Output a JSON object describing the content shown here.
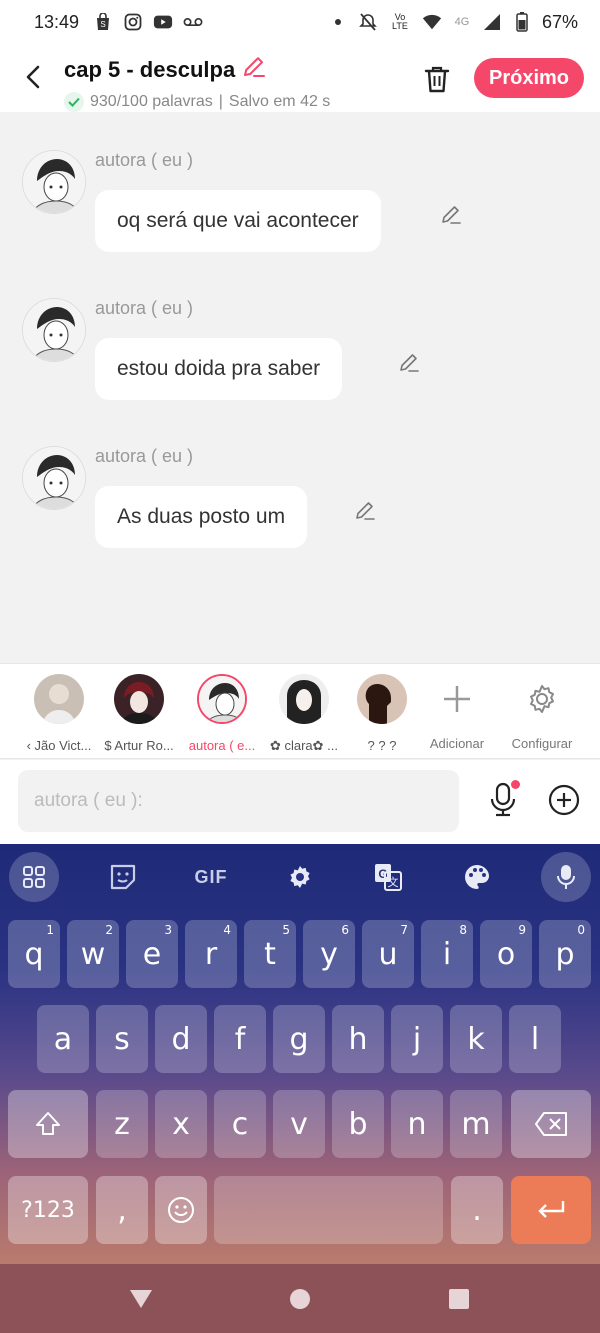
{
  "status_bar": {
    "time": "13:49",
    "battery": "67%",
    "network": "4G",
    "volte": "Vo LTE"
  },
  "header": {
    "title": "cap 5 - desculpa",
    "word_count": "930/100 palavras",
    "separator": "|",
    "saved": "Salvo em 42 s",
    "next_label": "Próximo",
    "accent_color": "#f5476a"
  },
  "messages": [
    {
      "author": "autora ( eu )",
      "text": "oq será que vai acontecer"
    },
    {
      "author": "autora ( eu )",
      "text": "estou doida pra saber"
    },
    {
      "author": "autora ( eu )",
      "text": "As duas posto um"
    }
  ],
  "characters": [
    {
      "name": "‹ Jão Vict...",
      "active": false
    },
    {
      "name": "$ Artur Ro...",
      "active": false
    },
    {
      "name": "autora ( e...",
      "active": true
    },
    {
      "name": "✿ clara✿ ...",
      "active": false
    },
    {
      "name": "? ? ?",
      "active": false
    }
  ],
  "tools": {
    "add_label": "Adicionar",
    "config_label": "Configurar"
  },
  "input": {
    "placeholder": "autora ( eu ):"
  },
  "keyboard": {
    "gif_label": "GIF",
    "row1": [
      {
        "k": "q",
        "h": "1"
      },
      {
        "k": "w",
        "h": "2"
      },
      {
        "k": "e",
        "h": "3"
      },
      {
        "k": "r",
        "h": "4"
      },
      {
        "k": "t",
        "h": "5"
      },
      {
        "k": "y",
        "h": "6"
      },
      {
        "k": "u",
        "h": "7"
      },
      {
        "k": "i",
        "h": "8"
      },
      {
        "k": "o",
        "h": "9"
      },
      {
        "k": "p",
        "h": "0"
      }
    ],
    "row2": [
      "a",
      "s",
      "d",
      "f",
      "g",
      "h",
      "j",
      "k",
      "l"
    ],
    "row3": [
      "z",
      "x",
      "c",
      "v",
      "b",
      "n",
      "m"
    ],
    "symbols_label": "?123",
    "comma": ",",
    "period": "."
  }
}
